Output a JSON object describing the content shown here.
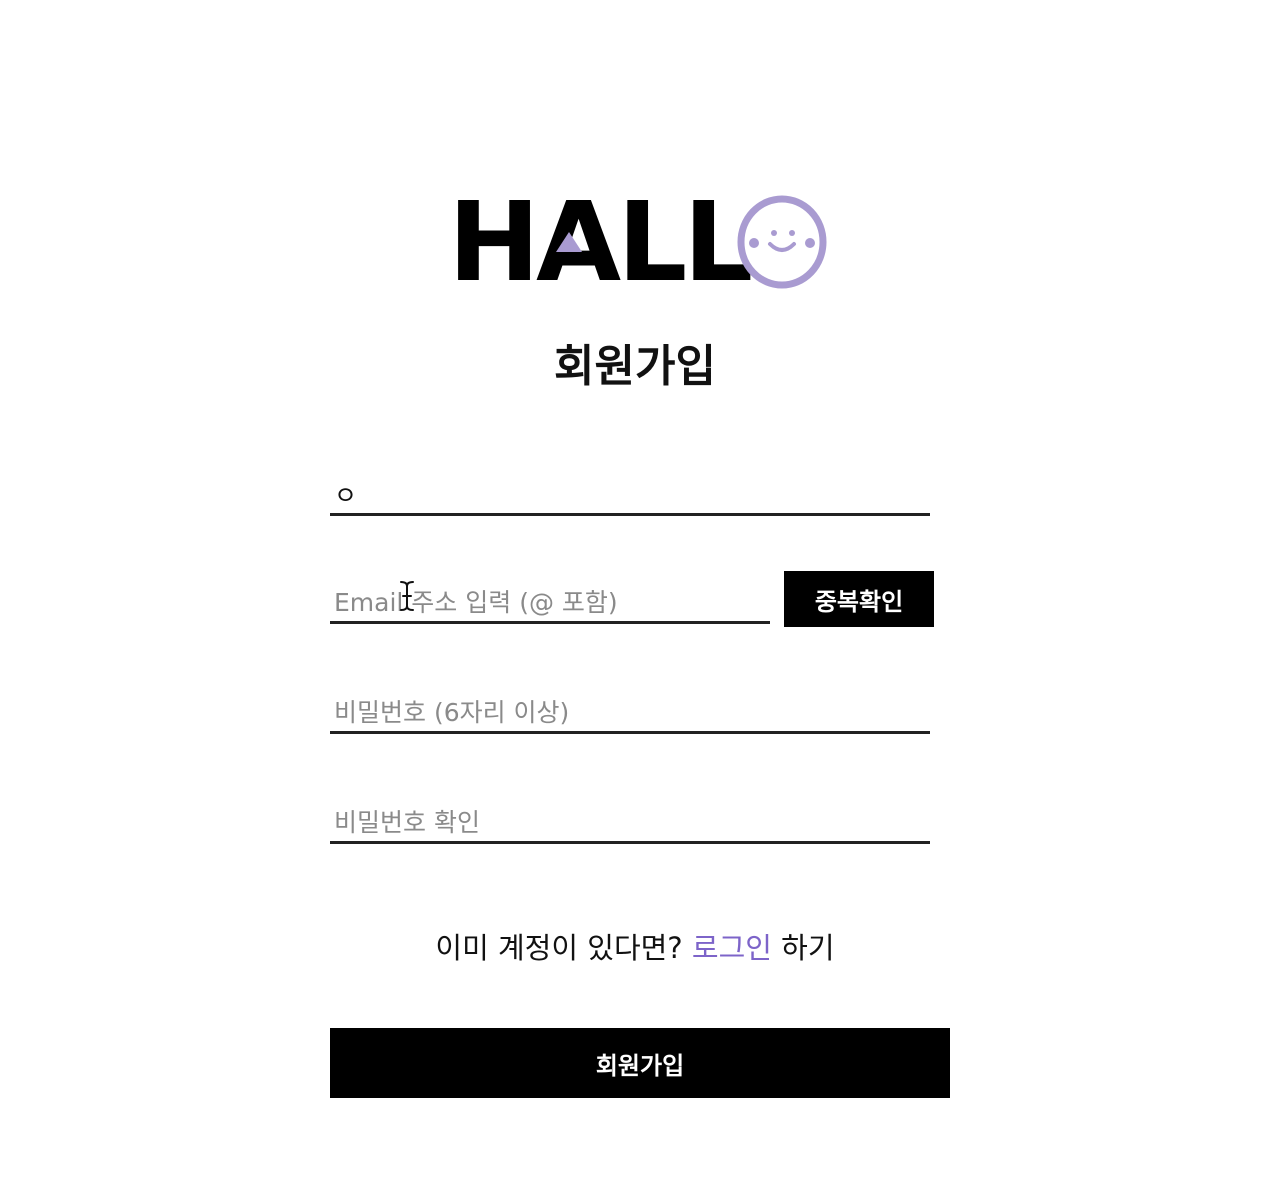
{
  "logo": {
    "text": "HALL",
    "face_icon": "smiley-face-icon",
    "accent_color": "#a99bd1"
  },
  "title": "회원가입",
  "form": {
    "name": {
      "value": "ㅇ",
      "placeholder": ""
    },
    "email": {
      "value": "",
      "placeholder": "Email 주소 입력 (@ 포함)"
    },
    "duplicate_check_label": "중복확인",
    "password": {
      "value": "",
      "placeholder": "비밀번호 (6자리 이상)"
    },
    "password_confirm": {
      "value": "",
      "placeholder": "비밀번호 확인"
    }
  },
  "login_prompt": {
    "prefix": "이미 계정이 있다면? ",
    "link": "로그인",
    "suffix": " 하기",
    "link_color": "#7d64c9"
  },
  "submit_label": "회원가입",
  "cursor_icon": "text-cursor-icon"
}
